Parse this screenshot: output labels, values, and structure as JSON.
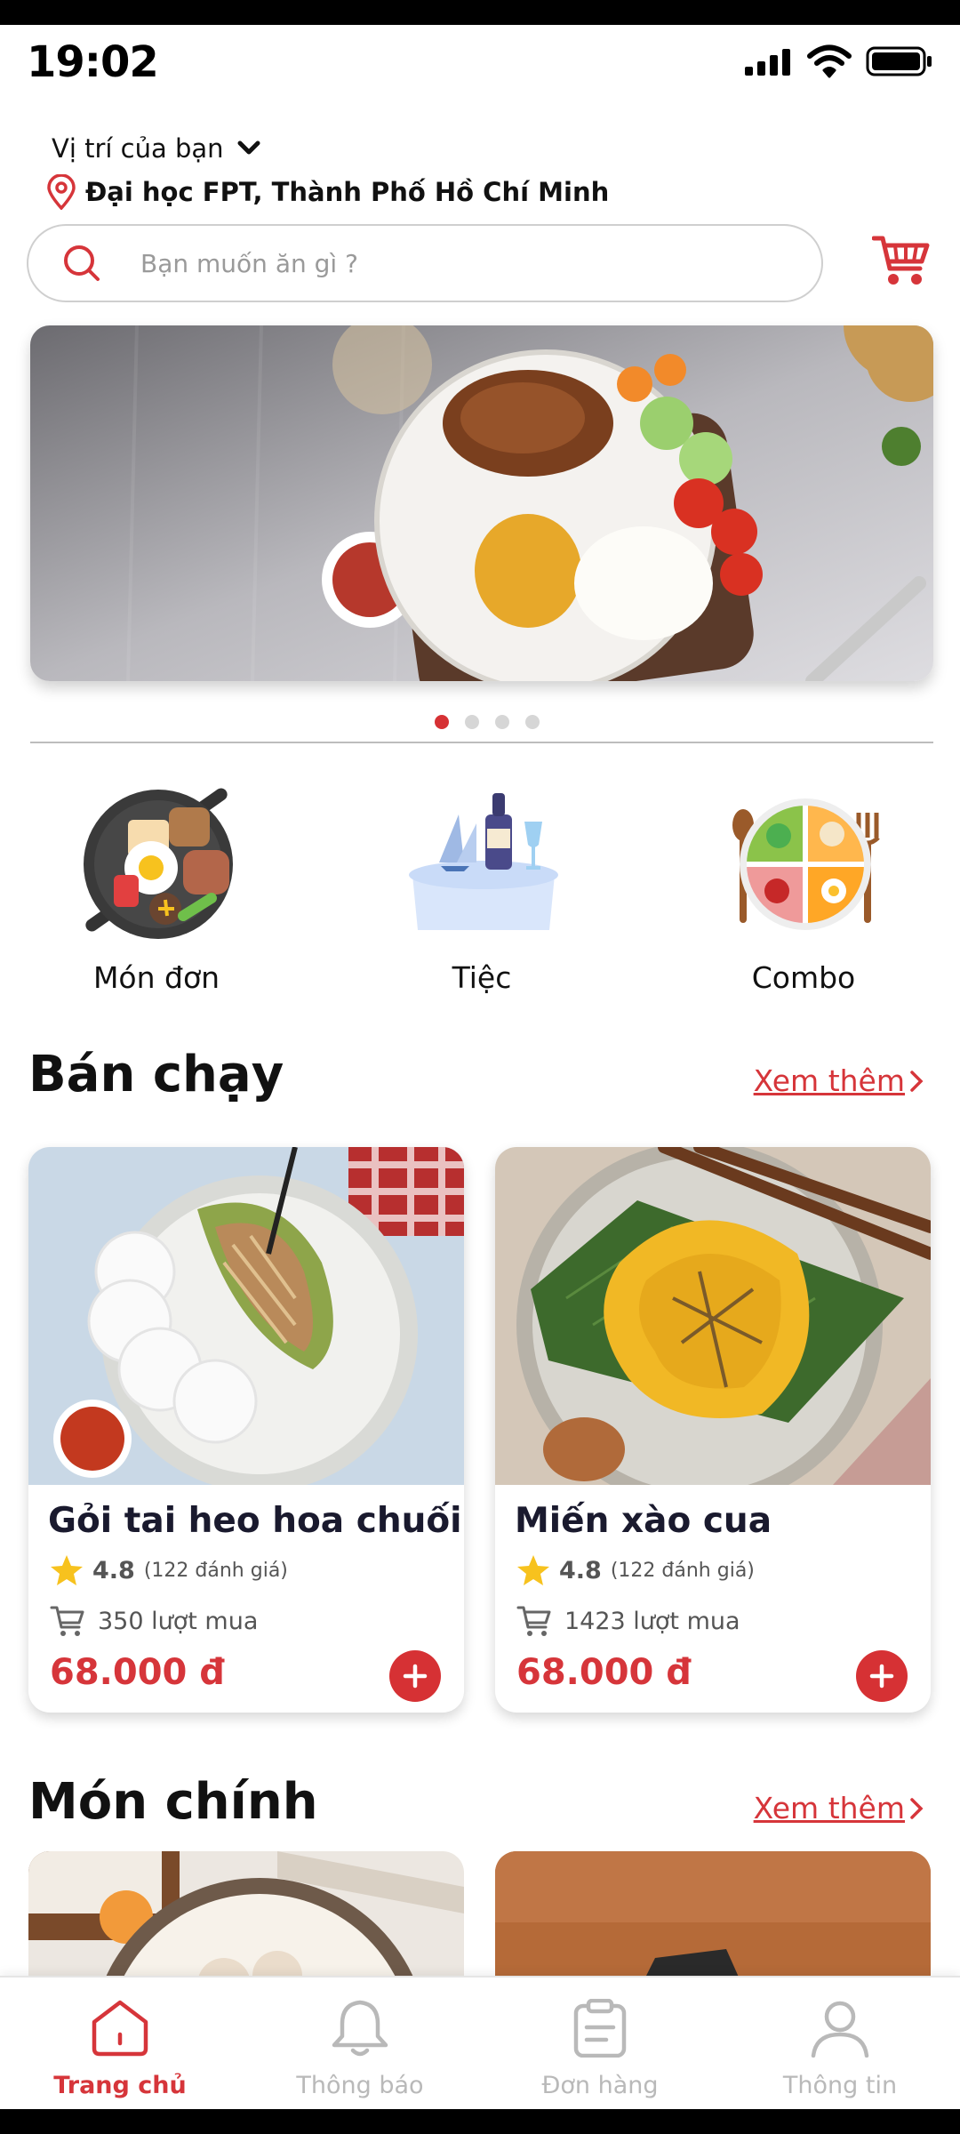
{
  "status_bar": {
    "time": "19:02"
  },
  "location": {
    "label": "Vị trí của bạn",
    "value": "Đại học FPT, Thành Phố Hồ Chí Minh"
  },
  "search": {
    "placeholder": "Bạn muốn ăn gì ?"
  },
  "banner": {
    "slides_total": 4,
    "active_index": 0
  },
  "categories": [
    {
      "label": "Món đơn",
      "icon": "grill-pan-icon"
    },
    {
      "label": "Tiệc",
      "icon": "party-table-icon"
    },
    {
      "label": "Combo",
      "icon": "combo-plate-icon"
    }
  ],
  "best_seller": {
    "title": "Bán chạy",
    "see_more": "Xem thêm",
    "items": [
      {
        "name": "Gỏi tai heo hoa chuối",
        "rating": "4.8",
        "reviews": "(122 đánh giá)",
        "sold": "350 lượt mua",
        "price": "68.000 đ"
      },
      {
        "name": "Miến xào cua",
        "rating": "4.8",
        "reviews": "(122 đánh giá)",
        "sold": "1423 lượt mua",
        "price": "68.000 đ"
      }
    ]
  },
  "main_dishes": {
    "title": "Món chính",
    "see_more": "Xem thêm"
  },
  "bottom_nav": [
    {
      "label": "Trang chủ",
      "icon": "home-icon",
      "active": true
    },
    {
      "label": "Thông báo",
      "icon": "bell-icon",
      "active": false
    },
    {
      "label": "Đơn hàng",
      "icon": "clipboard-icon",
      "active": false
    },
    {
      "label": "Thông tin",
      "icon": "user-icon",
      "active": false
    }
  ],
  "colors": {
    "accent": "#d6353a",
    "inactive": "#b9b9b9",
    "star": "#f7c21e"
  }
}
